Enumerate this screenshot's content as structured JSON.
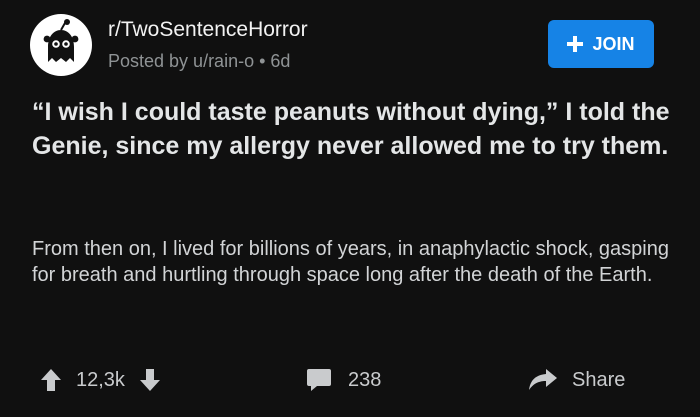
{
  "post": {
    "subreddit": "r/TwoSentenceHorror",
    "meta": "Posted by u/rain-o • 6d",
    "avatar_icon": "ghost-snoo-avatar",
    "join_label": "JOIN",
    "title": "“I wish I could taste peanuts without dying,” I told the Genie, since my allergy never allowed me to try them.",
    "body": "From then on, I lived for billions of years, in anaphylactic shock, gasping for breath and hurtling through space long after the death of the Earth."
  },
  "actions": {
    "upvotes": "12,3k",
    "comments": "238",
    "share_label": "Share"
  },
  "colors": {
    "background": "#101010",
    "accent": "#1683e6",
    "text_primary": "#e4e6e7",
    "text_secondary": "#8f9395"
  }
}
